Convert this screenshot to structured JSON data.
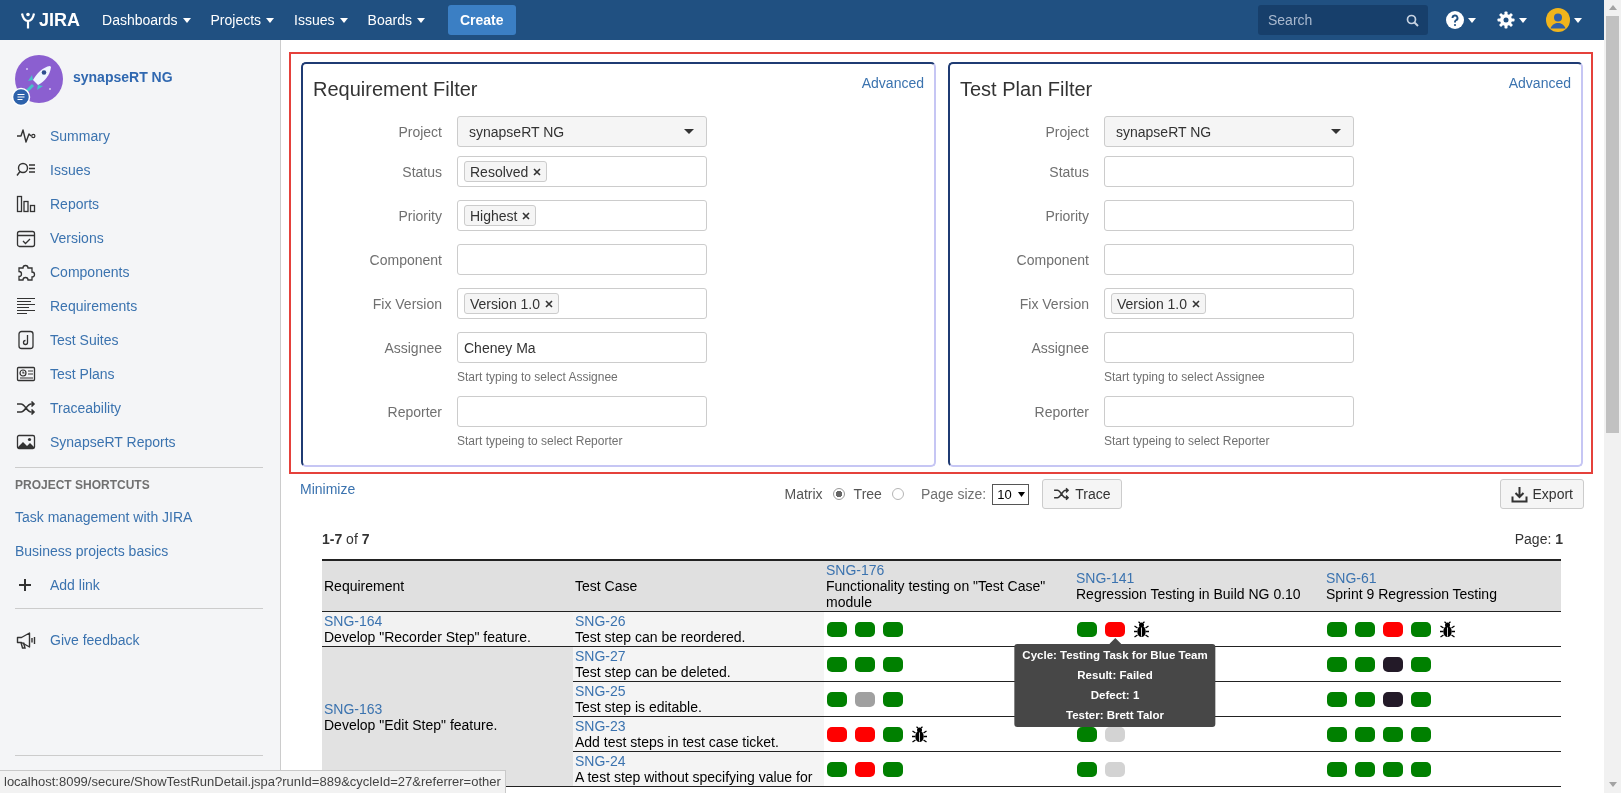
{
  "top_bar": {
    "logo_text": "JIRA",
    "menus": [
      "Dashboards",
      "Projects",
      "Issues",
      "Boards"
    ],
    "create_button": "Create",
    "search": {
      "placeholder": "Search"
    }
  },
  "sidebar": {
    "project_name": "synapseRT NG",
    "items": [
      {
        "label": "Summary",
        "selected": false
      },
      {
        "label": "Issues",
        "selected": false
      },
      {
        "label": "Reports",
        "selected": false
      },
      {
        "label": "Versions",
        "selected": false
      },
      {
        "label": "Components",
        "selected": false
      },
      {
        "label": "Requirements",
        "selected": false
      },
      {
        "label": "Test Suites",
        "selected": false
      },
      {
        "label": "Test Plans",
        "selected": false
      },
      {
        "label": "Traceability",
        "selected": false
      },
      {
        "label": "SynapseRT Reports",
        "selected": false
      }
    ],
    "shortcuts_heading": "PROJECT SHORTCUTS",
    "shortcuts": [
      "Task management with JIRA",
      "Business projects basics"
    ],
    "add_link": "Add link",
    "feedback": "Give feedback"
  },
  "filters": [
    {
      "title": "Requirement Filter",
      "advanced_link": "Advanced",
      "fields": [
        {
          "label": "Project",
          "kind": "select",
          "value": "synapseRT NG"
        },
        {
          "label": "Status",
          "kind": "tags",
          "tags": [
            "Resolved"
          ]
        },
        {
          "label": "Priority",
          "kind": "tags",
          "tags": [
            "Highest"
          ]
        },
        {
          "label": "Component",
          "kind": "tags"
        },
        {
          "label": "Fix Version",
          "kind": "tags",
          "tags": [
            "Version 1.0"
          ]
        },
        {
          "label": "Assignee",
          "kind": "text",
          "value": "Cheney Ma",
          "help": "Start typing to select Assignee"
        },
        {
          "label": "Reporter",
          "kind": "text",
          "help": "Start typeing to select Reporter"
        }
      ]
    },
    {
      "title": "Test Plan Filter",
      "advanced_link": "Advanced",
      "fields": [
        {
          "label": "Project",
          "kind": "select",
          "value": "synapseRT NG"
        },
        {
          "label": "Status",
          "kind": "tags"
        },
        {
          "label": "Priority",
          "kind": "tags"
        },
        {
          "label": "Component",
          "kind": "tags"
        },
        {
          "label": "Fix Version",
          "kind": "tags",
          "tags": [
            "Version 1.0"
          ]
        },
        {
          "label": "Assignee",
          "kind": "text",
          "help": "Start typing to select Assignee"
        },
        {
          "label": "Reporter",
          "kind": "text",
          "help": "Start typeing to select Reporter"
        }
      ]
    }
  ],
  "controls": {
    "minimize_link": "Minimize",
    "view_options": [
      {
        "label": "Matrix",
        "selected": true
      },
      {
        "label": "Tree",
        "selected": false
      }
    ],
    "page_size_label": "Page size:",
    "page_size": "10",
    "trace_button": "Trace",
    "export_button": "Export"
  },
  "results_summary": {
    "range": "**1-7** of **7**",
    "page": "Page: **1**"
  },
  "table": {
    "columns": [
      {
        "title": "Requirement"
      },
      {
        "title": "Test Case"
      },
      {
        "key": "SNG-176",
        "title": "Functionality testing on \"Test Case\" module"
      },
      {
        "key": "SNG-141",
        "title": "Regression Testing in Build NG 0.10"
      },
      {
        "key": "SNG-61",
        "title": "Sprint 9 Regression Testing"
      }
    ],
    "groups": [
      {
        "requirement": {
          "key": "SNG-164",
          "summary": "Develop \"Recorder Step\" feature."
        },
        "rows": [
          {
            "test_case": {
              "key": "SNG-26",
              "summary": "Test step can be reordered."
            },
            "results": {
              "plan_1": {
                "runs": [
                  {
                    "color": "#008000"
                  },
                  {
                    "color": "#008000"
                  },
                  {
                    "color": "#008000"
                  }
                ]
              },
              "plan_2": {
                "runs": [
                  {
                    "color": "#008000"
                  },
                  {
                    "color": "#ff0000",
                    "tooltip": {
                      "lines": [
                        "Cycle: Testing Task for Blue Team",
                        "Result: Failed",
                        "Defect: 1",
                        "Tester: Brett Talor"
                      ]
                    }
                  }
                ],
                "defect": true
              },
              "plan_3": {
                "runs": [
                  {
                    "color": "#008000"
                  },
                  {
                    "color": "#008000"
                  },
                  {
                    "color": "#ff0000"
                  },
                  {
                    "color": "#008000"
                  }
                ],
                "defect": true
              }
            }
          }
        ]
      },
      {
        "requirement": {
          "key": "SNG-163",
          "summary": "Develop \"Edit Step\" feature."
        },
        "rows": [
          {
            "test_case": {
              "key": "SNG-27",
              "summary": "Test step can be deleted."
            },
            "results": {
              "plan_1": {
                "runs": [
                  {
                    "color": "#008000"
                  },
                  {
                    "color": "#008000"
                  },
                  {
                    "color": "#008000"
                  }
                ]
              },
              "plan_3": {
                "runs": [
                  {
                    "color": "#008000"
                  },
                  {
                    "color": "#008000"
                  },
                  {
                    "color": "#231a28"
                  },
                  {
                    "color": "#008000"
                  }
                ]
              }
            }
          },
          {
            "test_case": {
              "key": "SNG-25",
              "summary": "Test step is editable."
            },
            "results": {
              "plan_1": {
                "runs": [
                  {
                    "color": "#008000"
                  },
                  {
                    "color": "#a0a0a0"
                  },
                  {
                    "color": "#008000"
                  }
                ]
              },
              "plan_3": {
                "runs": [
                  {
                    "color": "#008000"
                  },
                  {
                    "color": "#008000"
                  },
                  {
                    "color": "#231a28"
                  },
                  {
                    "color": "#008000"
                  }
                ]
              }
            }
          },
          {
            "test_case": {
              "key": "SNG-23",
              "summary": "Add test steps in test case ticket."
            },
            "results": {
              "plan_1": {
                "runs": [
                  {
                    "color": "#ff0000"
                  },
                  {
                    "color": "#ff0000"
                  },
                  {
                    "color": "#008000"
                  }
                ],
                "defect": true
              },
              "plan_2": {
                "runs": [
                  {
                    "color": "#008000"
                  },
                  {
                    "color": "#d3d3d3"
                  }
                ]
              },
              "plan_3": {
                "runs": [
                  {
                    "color": "#008000"
                  },
                  {
                    "color": "#008000"
                  },
                  {
                    "color": "#008000"
                  },
                  {
                    "color": "#008000"
                  }
                ]
              }
            }
          },
          {
            "test_case": {
              "key": "SNG-24",
              "summary": "A test step without specifying value for"
            },
            "results": {
              "plan_1": {
                "runs": [
                  {
                    "color": "#008000"
                  },
                  {
                    "color": "#ff0000"
                  },
                  {
                    "color": "#008000"
                  }
                ]
              },
              "plan_2": {
                "runs": [
                  {
                    "color": "#008000"
                  },
                  {
                    "color": "#d3d3d3"
                  }
                ]
              },
              "plan_3": {
                "runs": [
                  {
                    "color": "#008000"
                  },
                  {
                    "color": "#008000"
                  },
                  {
                    "color": "#008000"
                  },
                  {
                    "color": "#008000"
                  }
                ]
              }
            }
          }
        ]
      }
    ]
  },
  "status_bar": {
    "url": "localhost:8099/secure/ShowTestRunDetail.jspa?runId=889&cycleId=27&referrer=other"
  }
}
